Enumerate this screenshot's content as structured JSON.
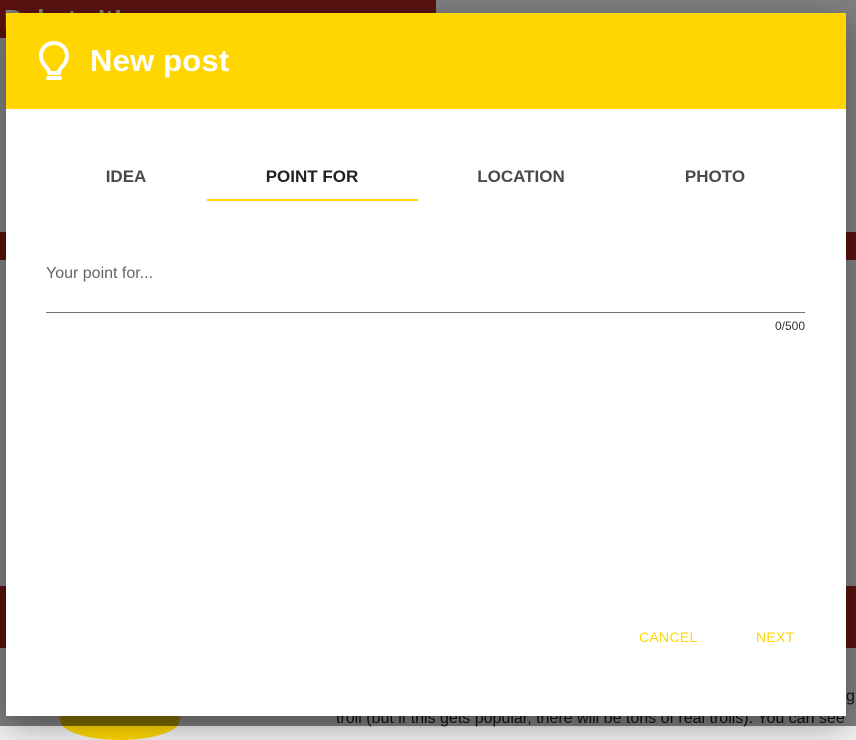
{
  "background": {
    "header_title": "Debate It!",
    "body_text": "troll (but if this gets popular, there will be tons of real trolls). You can see",
    "right_fragment": "g"
  },
  "dialog": {
    "title": "New post",
    "title_icon": "lightbulb-icon",
    "accent_color": "#ffd600"
  },
  "tabs": [
    {
      "label": "IDEA",
      "active": false
    },
    {
      "label": "POINT FOR",
      "active": true
    },
    {
      "label": "LOCATION",
      "active": false
    },
    {
      "label": "PHOTO",
      "active": false
    }
  ],
  "point_field": {
    "placeholder": "Your point for...",
    "value": "",
    "counter": "0/500"
  },
  "actions": {
    "cancel_label": "CANCEL",
    "next_label": "NEXT"
  }
}
